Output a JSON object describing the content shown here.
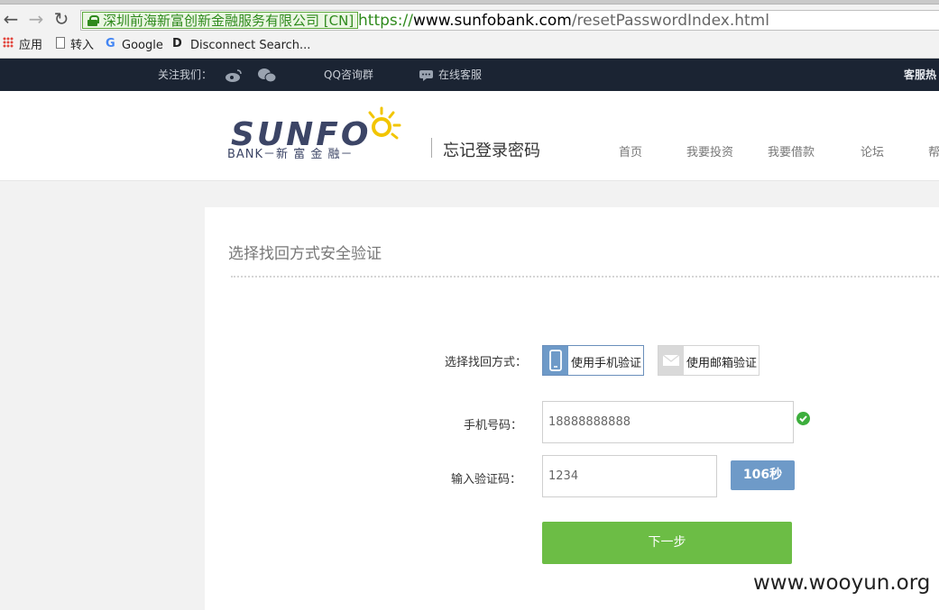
{
  "browser": {
    "ev_label": "深圳前海新富创新金融服务有限公司 [CN]",
    "url_scheme": "https://",
    "url_host": "www.sunfobank.com",
    "url_path": "/resetPasswordIndex.html",
    "bookmarks": [
      "应用",
      "转入",
      "Google",
      "Disconnect Search..."
    ]
  },
  "topbar": {
    "follow_label": "关注我们：",
    "qq_label": "QQ咨询群",
    "service_label": "在线客服",
    "hotline_label": "客服热"
  },
  "header": {
    "logo_text": "SUNFO",
    "logo_sub": "BANK－新 富 金 融－",
    "page_heading": "忘记登录密码",
    "nav": [
      "首页",
      "我要投资",
      "我要借款",
      "论坛",
      "帮"
    ]
  },
  "form": {
    "title": "选择找回方式安全验证",
    "method_label": "选择找回方式：",
    "method_phone": "使用手机验证",
    "method_email": "使用邮箱验证",
    "phone_label": "手机号码：",
    "phone_value": "18888888888",
    "code_label": "输入验证码：",
    "code_value": "1234",
    "timer_label": "106秒",
    "next_label": "下一步"
  },
  "watermark": "www.wooyun.org",
  "colors": {
    "topbar_bg": "#1b2433",
    "ev_green": "#2f8a1d",
    "timer_blue": "#6e9ac8",
    "next_green": "#6cbd45",
    "logo_navy": "#3c4566",
    "sun_yellow": "#f2c500"
  }
}
